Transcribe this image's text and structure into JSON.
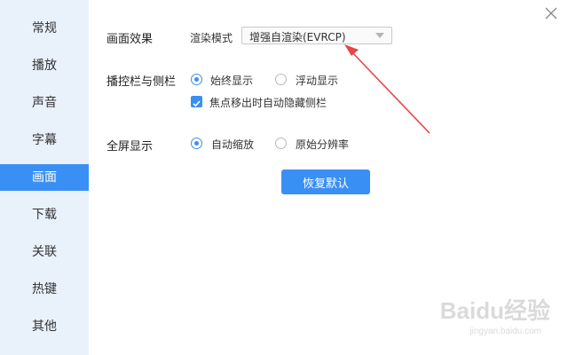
{
  "sidebar": {
    "items": [
      {
        "label": "常规"
      },
      {
        "label": "播放"
      },
      {
        "label": "声音"
      },
      {
        "label": "字幕"
      },
      {
        "label": "画面",
        "active": true
      },
      {
        "label": "下载"
      },
      {
        "label": "关联"
      },
      {
        "label": "热键"
      },
      {
        "label": "其他"
      }
    ]
  },
  "display": {
    "section_label": "画面效果",
    "render_mode_label": "渲染模式",
    "render_mode_value": "增强自渲染(EVRCP)"
  },
  "controls": {
    "section_label": "播控栏与侧栏",
    "options": [
      {
        "label": "始终显示",
        "checked": true
      },
      {
        "label": "浮动显示",
        "checked": false
      }
    ],
    "auto_hide": {
      "label": "焦点移出时自动隐藏侧栏",
      "checked": true
    }
  },
  "fullscreen": {
    "section_label": "全屏显示",
    "options": [
      {
        "label": "自动缩放",
        "checked": true
      },
      {
        "label": "原始分辨率",
        "checked": false
      }
    ]
  },
  "actions": {
    "reset_label": "恢复默认"
  },
  "watermark": {
    "text": "Baidu经验",
    "sub": "jingyan.baidu.com"
  },
  "colors": {
    "accent": "#3a8ff4",
    "sidebar_bg": "#e9f1fb",
    "annotation_arrow": "#e84545"
  }
}
